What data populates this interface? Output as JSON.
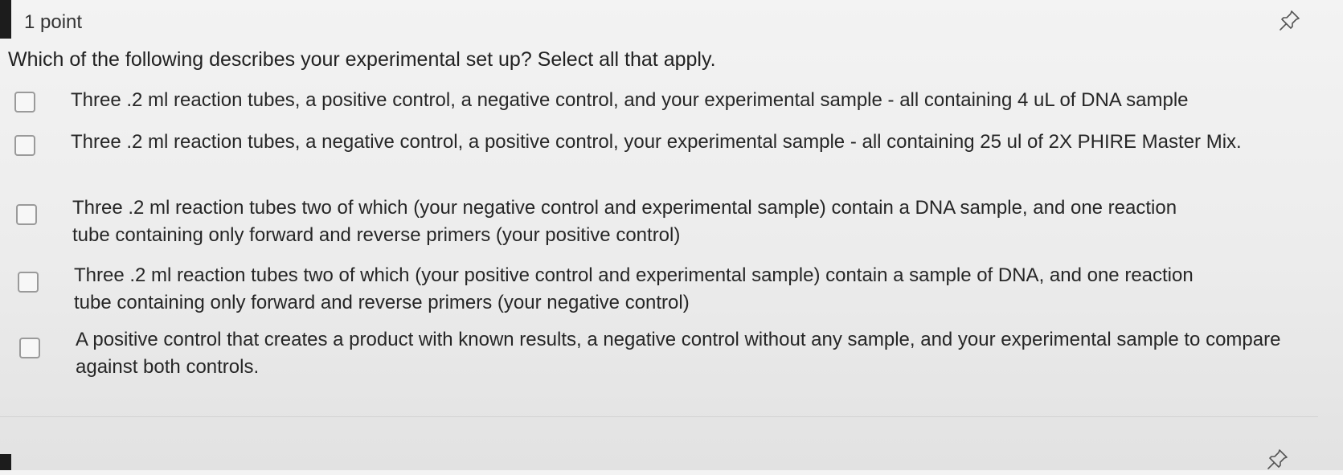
{
  "question": {
    "points": "1 point",
    "prompt": "Which of the following describes your experimental set up? Select all that apply.",
    "options": [
      {
        "label": "Three .2 ml reaction tubes, a positive control, a negative control, and your experimental sample - all containing 4 uL of DNA sample",
        "checked": false
      },
      {
        "label": "Three .2 ml reaction tubes, a negative control, a positive control, your experimental sample - all containing 25 ul of 2X PHIRE Master Mix.",
        "checked": false
      },
      {
        "label": "Three .2 ml reaction tubes two of which (your negative control and experimental sample) contain a DNA sample, and one reaction tube containing only forward and reverse primers (your positive control)",
        "checked": false
      },
      {
        "label": "Three .2 ml reaction tubes two of which (your positive control and experimental sample) contain a sample of DNA, and one reaction tube containing only forward and reverse primers (your negative control)",
        "checked": false
      },
      {
        "label": "A positive control that creates a product with known results, a negative control without any sample, and your experimental sample to compare against both controls.",
        "checked": false
      }
    ]
  },
  "icons": {
    "pin": "pin-icon"
  }
}
